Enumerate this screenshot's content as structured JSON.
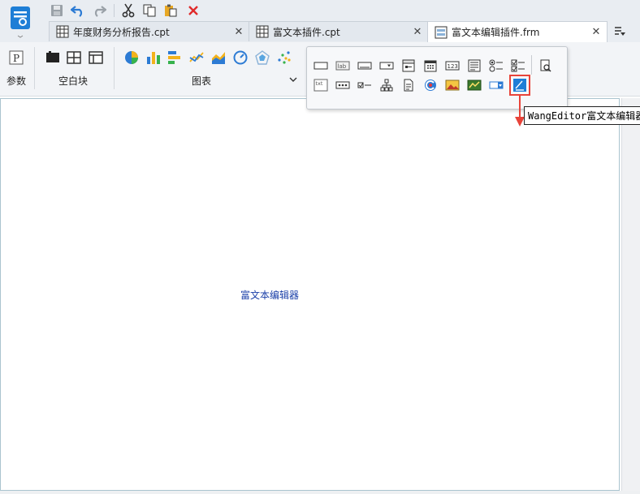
{
  "tabs": [
    {
      "label": "年度财务分析报告.cpt",
      "icon": "report-grid-icon"
    },
    {
      "label": "富文本插件.cpt",
      "icon": "report-grid-icon"
    },
    {
      "label": "富文本编辑插件.frm",
      "icon": "form-icon",
      "active": true
    }
  ],
  "ribbon": {
    "param_label": "参数",
    "blank_label": "空白块",
    "chart_label": "图表"
  },
  "canvas": {
    "widget_text": "富文本编辑器"
  },
  "popup": {
    "row1": [
      "button-widget-icon",
      "label-widget-icon",
      "textfield-widget-icon",
      "combobox-widget-icon",
      "tree-combobox-icon",
      "date-widget-icon",
      "number-widget-icon",
      "textarea-widget-icon",
      "radio-group-icon",
      "checkbox-group-icon",
      "preview-search-icon"
    ],
    "row2": [
      "text-widget-icon",
      "password-widget-icon",
      "checkbox-widget-icon",
      "tree-widget-icon",
      "file-widget-icon",
      "iframe-widget-icon",
      "image-widget-icon",
      "chart-widget-icon",
      "combo-check-icon",
      "rich-editor-icon"
    ]
  },
  "tooltip": {
    "text": "WangEditor富文本编辑器"
  },
  "colors": {
    "accent": "#1e7ed6",
    "highlight": "#e8443a",
    "canvas_text": "#1a3fa8"
  }
}
